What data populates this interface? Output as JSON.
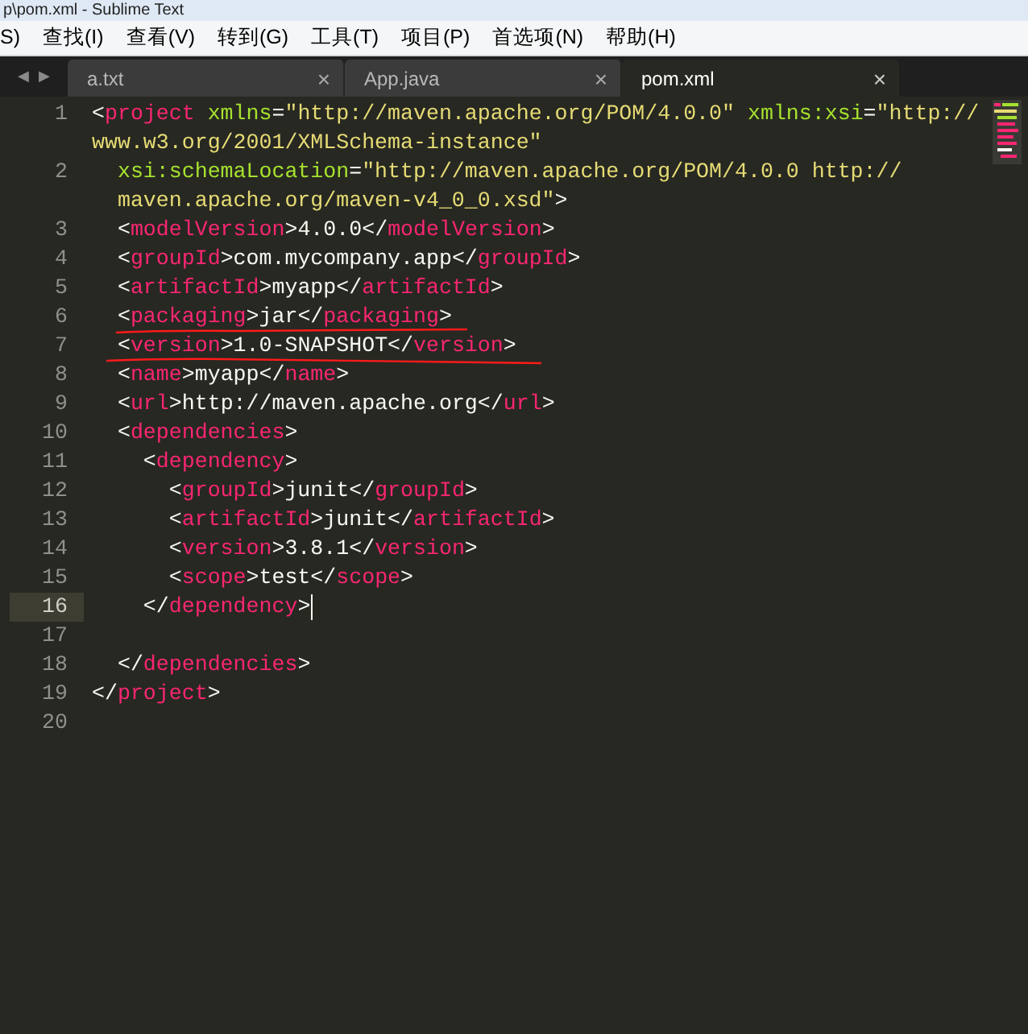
{
  "window": {
    "title": "p\\pom.xml - Sublime Text"
  },
  "menu": [
    "S)",
    "查找(I)",
    "查看(V)",
    "转到(G)",
    "工具(T)",
    "项目(P)",
    "首选项(N)",
    "帮助(H)"
  ],
  "nav": {
    "back": "◀",
    "forward": "▶"
  },
  "tabs": [
    {
      "label": "a.txt",
      "close": "×",
      "selected": false
    },
    {
      "label": "App.java",
      "close": "×",
      "selected": false
    },
    {
      "label": "pom.xml",
      "close": "×",
      "selected": true
    }
  ],
  "editor": {
    "lines": [
      {
        "number": "1",
        "current": false,
        "segments": [
          {
            "text": "<"
          },
          {
            "tag": "project"
          },
          {
            "attr": " xmlns"
          },
          {
            "text": "="
          },
          {
            "string": "\"http://maven.apache.org/POM/4.0.0\""
          },
          {
            "attr": " xmlns:xsi"
          },
          {
            "text": "="
          },
          {
            "string": "\"http://"
          }
        ],
        "continuation": [
          {
            "string": "www.w3.org/2001/XMLSchema-instance\""
          }
        ]
      },
      {
        "number": "2",
        "current": false,
        "segments": [
          {
            "attr": "  xsi:schemaLocation"
          },
          {
            "text": "="
          },
          {
            "string": "\"http://maven.apache.org/POM/4.0.0 http://"
          }
        ],
        "continuation": [
          {
            "string": "  maven.apache.org/maven-v4_0_0.xsd\""
          },
          {
            "text": ">"
          }
        ]
      },
      {
        "number": "3",
        "current": false,
        "segments": [
          {
            "text": "  <"
          },
          {
            "tag": "modelVersion"
          },
          {
            "text": ">4.0.0</"
          },
          {
            "tag": "modelVersion"
          },
          {
            "text": ">"
          }
        ]
      },
      {
        "number": "4",
        "current": false,
        "segments": [
          {
            "text": "  <"
          },
          {
            "tag": "groupId"
          },
          {
            "text": ">com.mycompany.app</"
          },
          {
            "tag": "groupId"
          },
          {
            "text": ">"
          }
        ]
      },
      {
        "number": "5",
        "current": false,
        "segments": [
          {
            "text": "  <"
          },
          {
            "tag": "artifactId"
          },
          {
            "text": ">myapp</"
          },
          {
            "tag": "artifactId"
          },
          {
            "text": ">"
          }
        ]
      },
      {
        "number": "6",
        "current": false,
        "segments": [
          {
            "text": "  <"
          },
          {
            "tag": "packaging"
          },
          {
            "text": ">jar</"
          },
          {
            "tag": "packaging"
          },
          {
            "text": ">"
          }
        ]
      },
      {
        "number": "7",
        "current": false,
        "segments": [
          {
            "text": "  <"
          },
          {
            "tag": "version"
          },
          {
            "text": ">1.0-SNAPSHOT</"
          },
          {
            "tag": "version"
          },
          {
            "text": ">"
          }
        ]
      },
      {
        "number": "8",
        "current": false,
        "segments": [
          {
            "text": "  <"
          },
          {
            "tag": "name"
          },
          {
            "text": ">myapp</"
          },
          {
            "tag": "name"
          },
          {
            "text": ">"
          }
        ]
      },
      {
        "number": "9",
        "current": false,
        "segments": [
          {
            "text": "  <"
          },
          {
            "tag": "url"
          },
          {
            "text": ">http://maven.apache.org</"
          },
          {
            "tag": "url"
          },
          {
            "text": ">"
          }
        ]
      },
      {
        "number": "10",
        "current": false,
        "segments": [
          {
            "text": "  <"
          },
          {
            "tag": "dependencies"
          },
          {
            "text": ">"
          }
        ]
      },
      {
        "number": "11",
        "current": false,
        "segments": [
          {
            "text": "    <"
          },
          {
            "tag": "dependency"
          },
          {
            "text": ">"
          }
        ]
      },
      {
        "number": "12",
        "current": false,
        "segments": [
          {
            "text": "      <"
          },
          {
            "tag": "groupId"
          },
          {
            "text": ">junit</"
          },
          {
            "tag": "groupId"
          },
          {
            "text": ">"
          }
        ]
      },
      {
        "number": "13",
        "current": false,
        "segments": [
          {
            "text": "      <"
          },
          {
            "tag": "artifactId"
          },
          {
            "text": ">junit</"
          },
          {
            "tag": "artifactId"
          },
          {
            "text": ">"
          }
        ]
      },
      {
        "number": "14",
        "current": false,
        "segments": [
          {
            "text": "      <"
          },
          {
            "tag": "version"
          },
          {
            "text": ">3.8.1</"
          },
          {
            "tag": "version"
          },
          {
            "text": ">"
          }
        ]
      },
      {
        "number": "15",
        "current": false,
        "segments": [
          {
            "text": "      <"
          },
          {
            "tag": "scope"
          },
          {
            "text": ">test</"
          },
          {
            "tag": "scope"
          },
          {
            "text": ">"
          }
        ]
      },
      {
        "number": "16",
        "current": true,
        "segments": [
          {
            "text": "    </"
          },
          {
            "tag": "dependency"
          },
          {
            "text": ">"
          }
        ]
      },
      {
        "number": "17",
        "current": false
      },
      {
        "number": "18",
        "current": false,
        "segments": [
          {
            "text": "  </"
          },
          {
            "tag": "dependencies"
          },
          {
            "text": ">"
          }
        ]
      },
      {
        "number": "19",
        "current": false,
        "segments": [
          {
            "text": "</"
          },
          {
            "tag": "project"
          },
          {
            "text": ">"
          }
        ]
      },
      {
        "number": "20",
        "current": false
      }
    ]
  }
}
